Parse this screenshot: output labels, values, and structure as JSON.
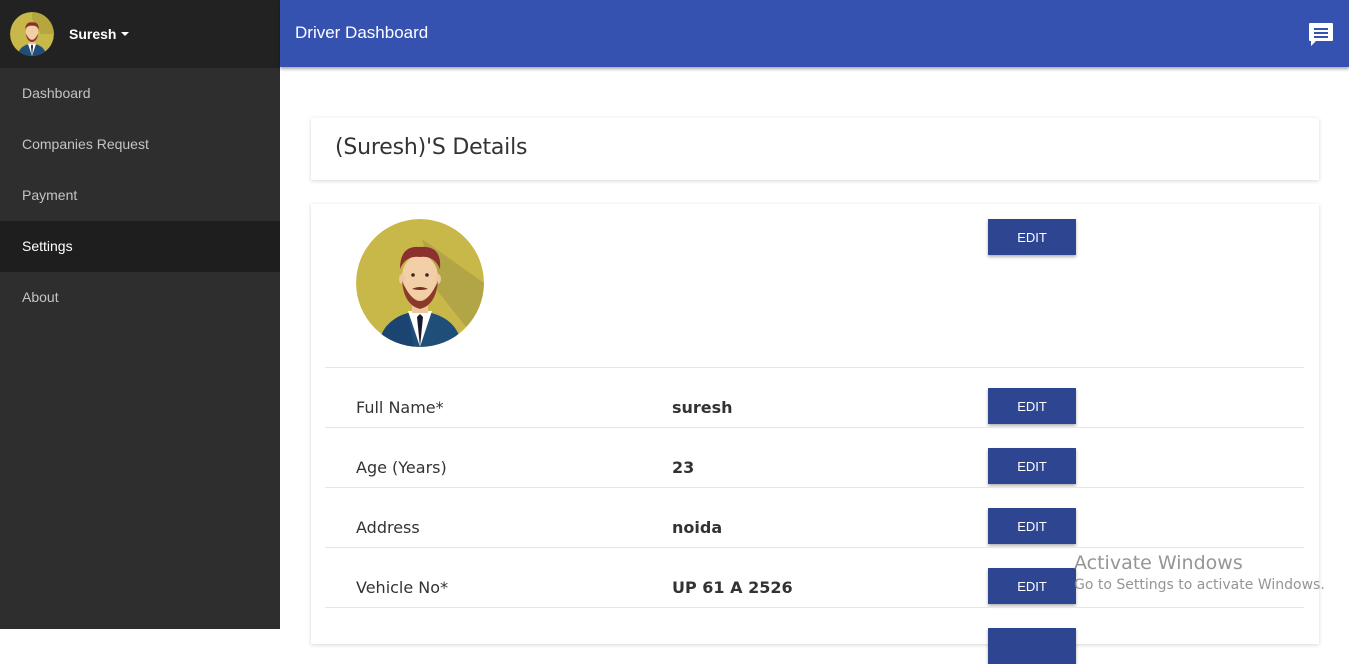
{
  "user": {
    "name": "Suresh"
  },
  "nav": {
    "items": [
      {
        "label": "Dashboard"
      },
      {
        "label": "Companies Request"
      },
      {
        "label": "Payment"
      },
      {
        "label": "Settings"
      },
      {
        "label": "About"
      }
    ],
    "active": "Settings"
  },
  "header": {
    "title": "Driver Dashboard",
    "chat_icon": "chat-icon"
  },
  "details": {
    "title": "(Suresh)'S Details",
    "edit_label": "EDIT",
    "fields": [
      {
        "label": "Full Name*",
        "value": "suresh"
      },
      {
        "label": "Age (Years)",
        "value": "23"
      },
      {
        "label": "Address",
        "value": "noida"
      },
      {
        "label": "Vehicle No*",
        "value": "UP 61 A 2526"
      }
    ]
  },
  "watermark": {
    "title": "Activate Windows",
    "subtitle": "Go to Settings to activate Windows."
  },
  "colors": {
    "header": "#3552b0",
    "sidebar": "#2f2e2f",
    "button": "#2e4592"
  }
}
